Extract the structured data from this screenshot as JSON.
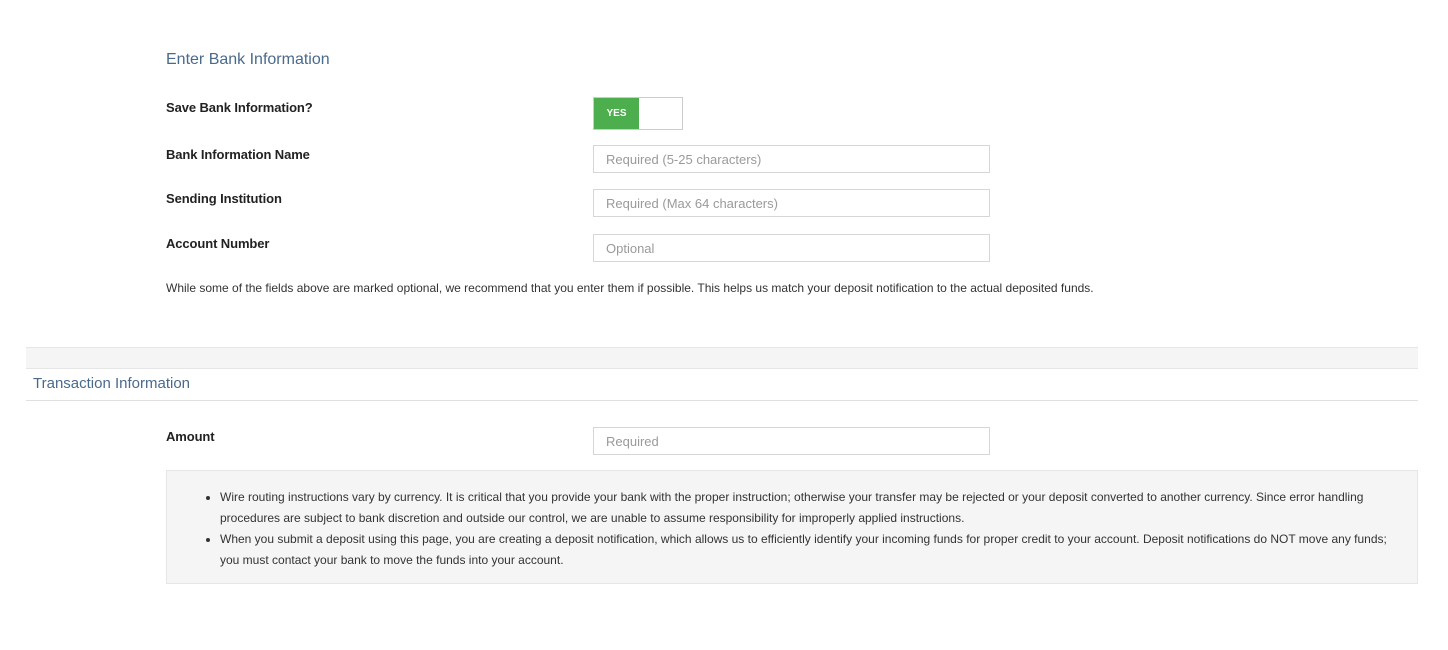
{
  "bank_section": {
    "title": "Enter Bank Information",
    "save_label": "Save Bank Information?",
    "save_toggle": "YES",
    "name_label": "Bank Information Name",
    "name_placeholder": "Required (5-25 characters)",
    "institution_label": "Sending Institution",
    "institution_placeholder": "Required (Max 64 characters)",
    "account_label": "Account Number",
    "account_placeholder": "Optional",
    "note": "While some of the fields above are marked optional, we recommend that you enter them if possible. This helps us match your deposit notification to the actual deposited funds."
  },
  "transaction_section": {
    "title": "Transaction Information",
    "amount_label": "Amount",
    "amount_placeholder": "Required",
    "info_items": [
      "Wire routing instructions vary by currency. It is critical that you provide your bank with the proper instruction; otherwise your transfer may be rejected or your deposit converted to another currency. Since error handling procedures are subject to bank discretion and outside our control, we are unable to assume responsibility for improperly applied instructions.",
      "When you submit a deposit using this page, you are creating a deposit notification, which allows us to efficiently identify your incoming funds for proper credit to your account. Deposit notifications do NOT move any funds; you must contact your bank to move the funds into your account."
    ]
  },
  "colors": {
    "accent_title": "#4a6a8c",
    "toggle_on": "#4cae4c",
    "info_background": "#f5f5f5"
  }
}
